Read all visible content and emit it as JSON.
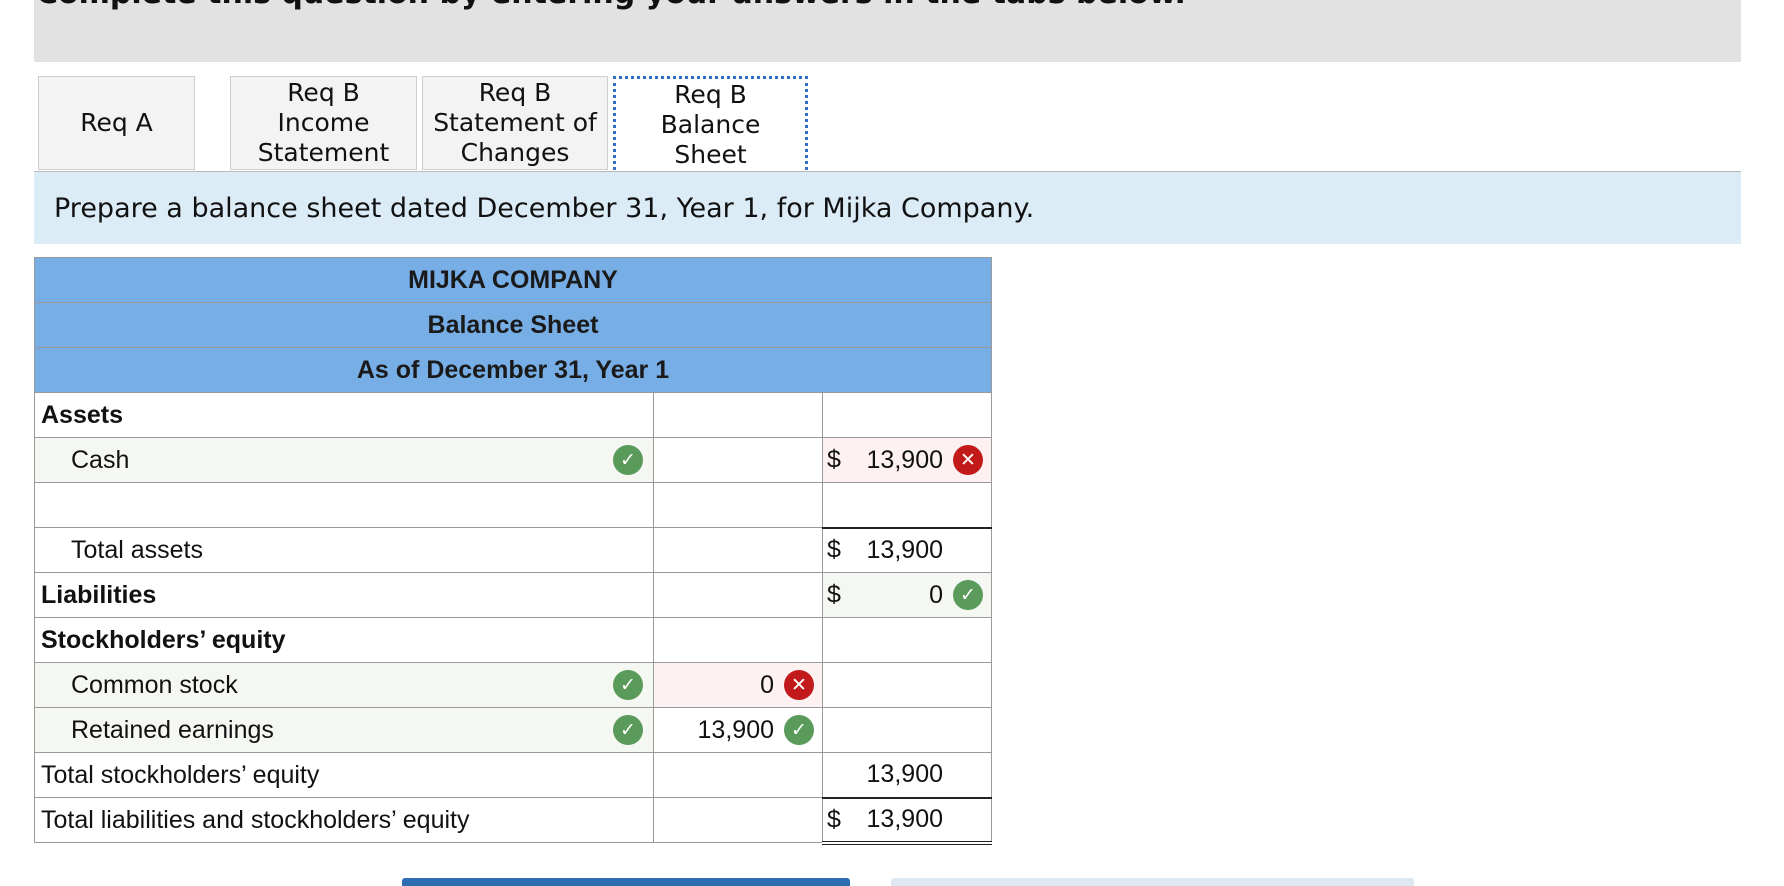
{
  "instructions": "Complete this question by entering your answers in the tabs below.",
  "tabs": [
    {
      "label": "Req A"
    },
    {
      "label": "Req B Income Statement"
    },
    {
      "label": "Req B Statement of Changes"
    },
    {
      "label": "Req B Balance Sheet"
    }
  ],
  "prompt": "Prepare a balance sheet dated December 31, Year 1, for Mijka Company.",
  "sheet": {
    "company": "MIJKA COMPANY",
    "title": "Balance Sheet",
    "date": "As of December 31, Year 1",
    "assets_label": "Assets",
    "cash_label": "Cash",
    "cash_amount": "13,900",
    "total_assets_label": "Total assets",
    "total_assets": "13,900",
    "liabilities_label": "Liabilities",
    "liabilities_amount": "0",
    "equity_label": "Stockholders’ equity",
    "common_stock_label": "Common stock",
    "common_stock_amount": "0",
    "retained_earnings_label": "Retained earnings",
    "retained_earnings_amount": "13,900",
    "total_equity_label": "Total stockholders’ equity",
    "total_equity": "13,900",
    "total_le_label": "Total liabilities and stockholders’ equity",
    "total_le": "13,900",
    "currency": "$"
  },
  "icons": {
    "correct": "check-icon",
    "incorrect": "x-icon"
  },
  "colors": {
    "header_bg": "#77aee6",
    "correct": "#5a9a5a",
    "incorrect": "#c21a1a",
    "prompt_bg": "#dcecf7"
  }
}
